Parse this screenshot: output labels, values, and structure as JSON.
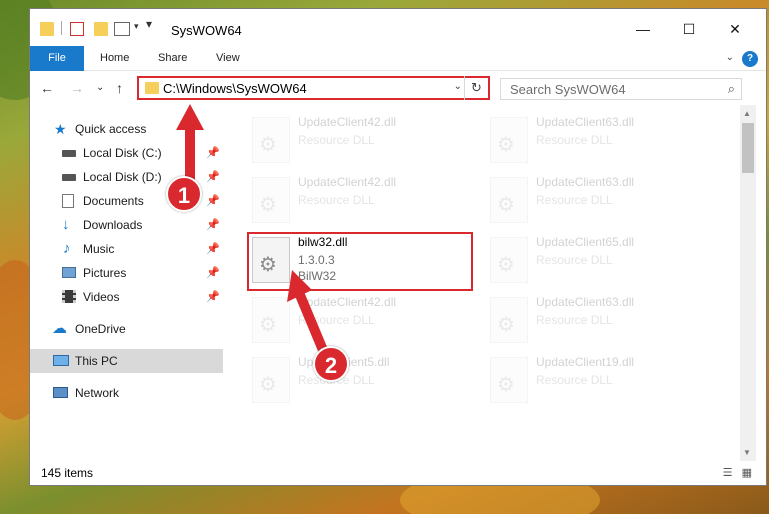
{
  "window": {
    "title": "SysWOW64",
    "controls": {
      "minimize": "—",
      "maximize": "☐",
      "close": "✕"
    }
  },
  "ribbon": {
    "tabs": [
      "File",
      "Home",
      "Share",
      "View"
    ],
    "help": "?",
    "collapse": "⌄"
  },
  "navigation": {
    "back": "←",
    "forward": "→",
    "recent": "⌄",
    "up": "↑",
    "address_path": "C:\\Windows\\SysWOW64",
    "search_placeholder": "Search SysWOW64"
  },
  "sidebar": {
    "items": [
      {
        "label": "Quick access",
        "icon": "star-icon",
        "pinned": false
      },
      {
        "label": "Local Disk (C:)",
        "icon": "drive-icon",
        "pinned": true
      },
      {
        "label": "Local Disk (D:)",
        "icon": "drive-icon",
        "pinned": true
      },
      {
        "label": "Documents",
        "icon": "documents-icon",
        "pinned": true
      },
      {
        "label": "Downloads",
        "icon": "download-icon",
        "pinned": true
      },
      {
        "label": "Music",
        "icon": "music-icon",
        "pinned": true
      },
      {
        "label": "Pictures",
        "icon": "pictures-icon",
        "pinned": true
      },
      {
        "label": "Videos",
        "icon": "video-icon",
        "pinned": true
      },
      {
        "label": "OneDrive",
        "icon": "cloud-icon",
        "pinned": false
      },
      {
        "label": "This PC",
        "icon": "computer-icon",
        "pinned": false,
        "selected": true
      },
      {
        "label": "Network",
        "icon": "network-icon",
        "pinned": false
      }
    ]
  },
  "files": [
    {
      "name": "UpdateClient42.dll",
      "line2": "Resource DLL",
      "line3": "",
      "faded": true
    },
    {
      "name": "UpdateClient63.dll",
      "line2": "Resource DLL",
      "line3": "",
      "faded": true
    },
    {
      "name": "UpdateClient42.dll",
      "line2": "Resource DLL",
      "line3": "",
      "faded": true
    },
    {
      "name": "UpdateClient63.dll",
      "line2": "Resource DLL",
      "line3": "",
      "faded": true
    },
    {
      "name": "bilw32.dll",
      "line2": "1.3.0.3",
      "line3": "BilW32",
      "faded": false
    },
    {
      "name": "UpdateClient65.dll",
      "line2": "Resource DLL",
      "line3": "",
      "faded": true
    },
    {
      "name": "UpdateClient42.dll",
      "line2": "Resource DLL",
      "line3": "",
      "faded": true
    },
    {
      "name": "UpdateClient63.dll",
      "line2": "Resource DLL",
      "line3": "",
      "faded": true
    },
    {
      "name": "UpdateClient5.dll",
      "line2": "Resource DLL",
      "line3": "",
      "faded": true
    },
    {
      "name": "UpdateClient19.dll",
      "line2": "Resource DLL",
      "line3": "",
      "faded": true
    }
  ],
  "status": {
    "item_count": "145 items"
  },
  "callouts": [
    "1",
    "2"
  ],
  "colors": {
    "accent": "#1979ca",
    "highlight": "#d9292e",
    "folder": "#f6cf5a"
  }
}
